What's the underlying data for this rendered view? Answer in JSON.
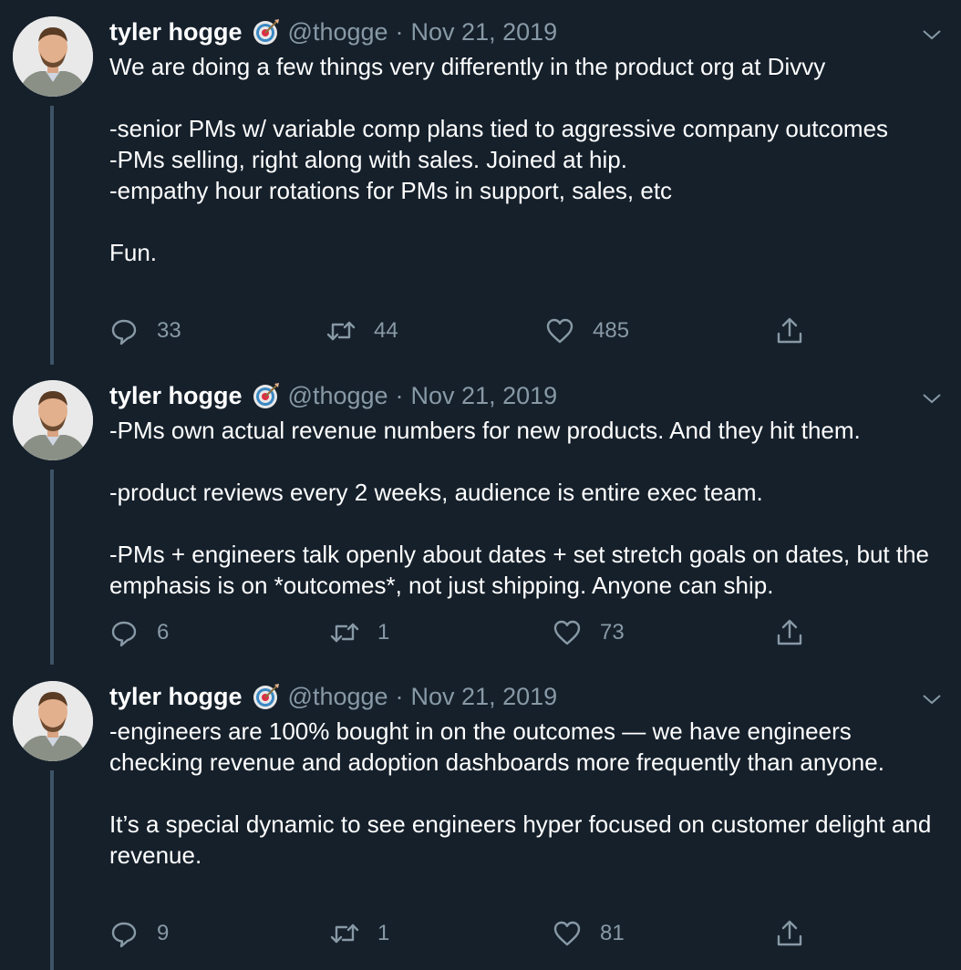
{
  "tweets": [
    {
      "author_name": "tyler hogge",
      "handle": "@thogge",
      "separator": "·",
      "date": "Nov 21, 2019",
      "text": "We are doing a few things very differently in the product org at Divvy\n\n-senior PMs w/ variable comp plans tied to aggressive company outcomes\n-PMs selling, right along with sales. Joined at hip.\n-empathy hour rotations for PMs in support, sales, etc\n\nFun.",
      "replies": "33",
      "retweets": "44",
      "likes": "485"
    },
    {
      "author_name": "tyler hogge",
      "handle": "@thogge",
      "separator": "·",
      "date": "Nov 21, 2019",
      "text": "-PMs own actual revenue numbers for new products. And they hit them.\n\n-product reviews every 2 weeks, audience is entire exec team.\n\n-PMs + engineers talk openly about dates + set stretch goals on dates, but the emphasis is on *outcomes*, not just shipping. Anyone can ship.",
      "replies": "6",
      "retweets": "1",
      "likes": "73"
    },
    {
      "author_name": "tyler hogge",
      "handle": "@thogge",
      "separator": "·",
      "date": "Nov 21, 2019",
      "text": "-engineers are 100% bought in on the outcomes — we have engineers checking revenue and adoption dashboards more frequently than anyone.\n\nIt’s a special dynamic to see engineers hyper focused on customer delight and revenue.",
      "replies": "9",
      "retweets": "1",
      "likes": "81"
    }
  ],
  "icons": {
    "reply": "reply-icon",
    "retweet": "retweet-icon",
    "like": "heart-icon",
    "share": "share-icon",
    "menu": "chevron-down-icon",
    "badge": "target-emoji-icon"
  },
  "colors": {
    "background": "#15202b",
    "text": "#ffffff",
    "secondary_text": "#8899a6",
    "thread_line": "#3d5466"
  }
}
